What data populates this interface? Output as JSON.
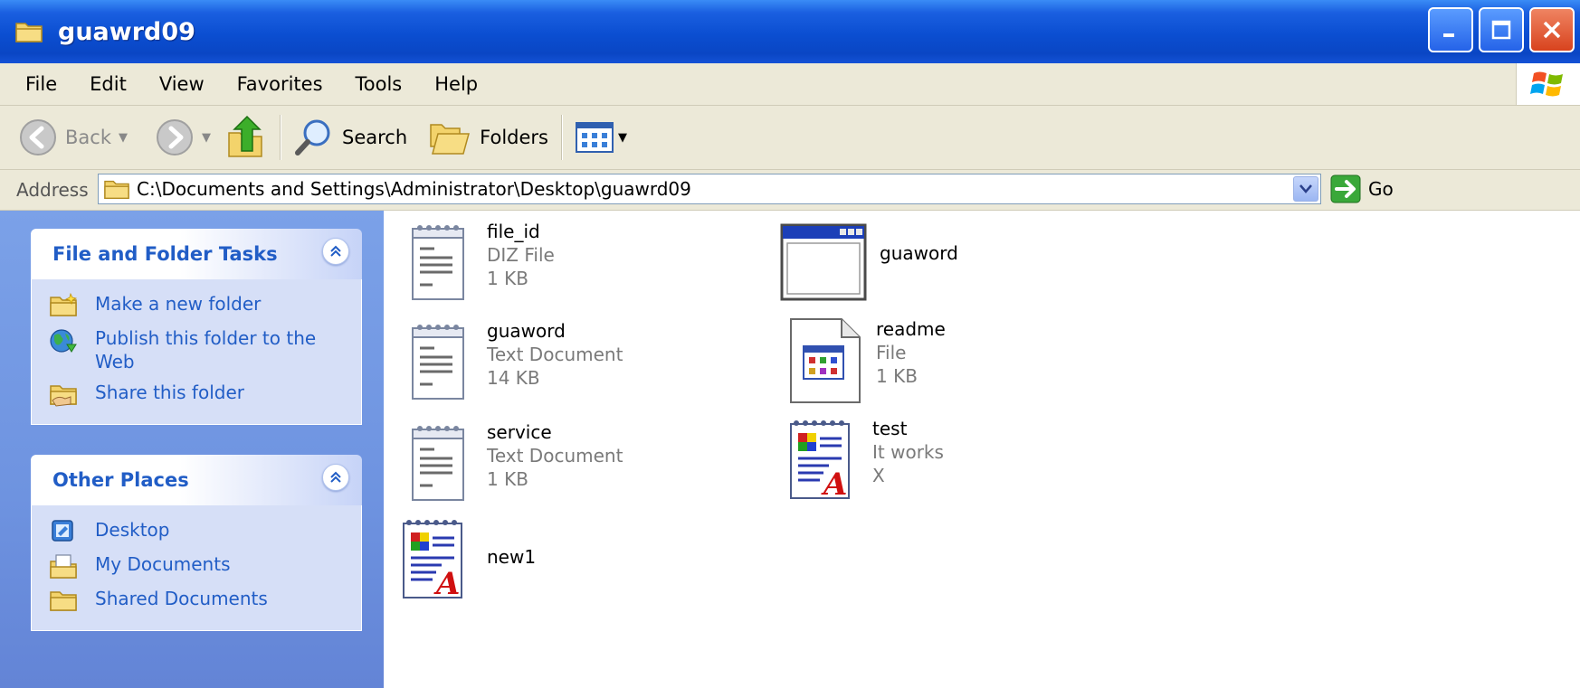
{
  "window": {
    "title": "guawrd09"
  },
  "menu": [
    "File",
    "Edit",
    "View",
    "Favorites",
    "Tools",
    "Help"
  ],
  "toolbar": {
    "back_label": "Back",
    "search_label": "Search",
    "folders_label": "Folders"
  },
  "address": {
    "label": "Address",
    "value": "C:\\Documents and Settings\\Administrator\\Desktop\\guawrd09",
    "go_label": "Go"
  },
  "task_pane": {
    "file_folder_tasks": {
      "title": "File and Folder Tasks",
      "items": [
        {
          "label": "Make a new folder",
          "icon": "new-folder-icon"
        },
        {
          "label": "Publish this folder to the Web",
          "icon": "publish-web-icon"
        },
        {
          "label": "Share this folder",
          "icon": "share-folder-icon"
        }
      ]
    },
    "other_places": {
      "title": "Other Places",
      "items": [
        {
          "label": "Desktop",
          "icon": "desktop-icon"
        },
        {
          "label": "My Documents",
          "icon": "my-documents-icon"
        },
        {
          "label": "Shared Documents",
          "icon": "shared-documents-icon"
        }
      ]
    }
  },
  "files": [
    {
      "name": "file_id",
      "type": "DIZ File",
      "size": "1 KB",
      "icon": "notepad-icon"
    },
    {
      "name": "guaword",
      "type": "",
      "size": "",
      "icon": "application-window-icon"
    },
    {
      "name": "guaword",
      "type": "Text Document",
      "size": "14 KB",
      "icon": "notepad-icon"
    },
    {
      "name": "readme",
      "type": "File",
      "size": "1 KB",
      "icon": "generic-file-icon"
    },
    {
      "name": "service",
      "type": "Text Document",
      "size": "1 KB",
      "icon": "notepad-icon"
    },
    {
      "name": "test",
      "type": "It works",
      "size": "X",
      "icon": "wordpad-document-icon"
    },
    {
      "name": "new1",
      "type": "",
      "size": "",
      "icon": "wordpad-document-icon"
    }
  ]
}
